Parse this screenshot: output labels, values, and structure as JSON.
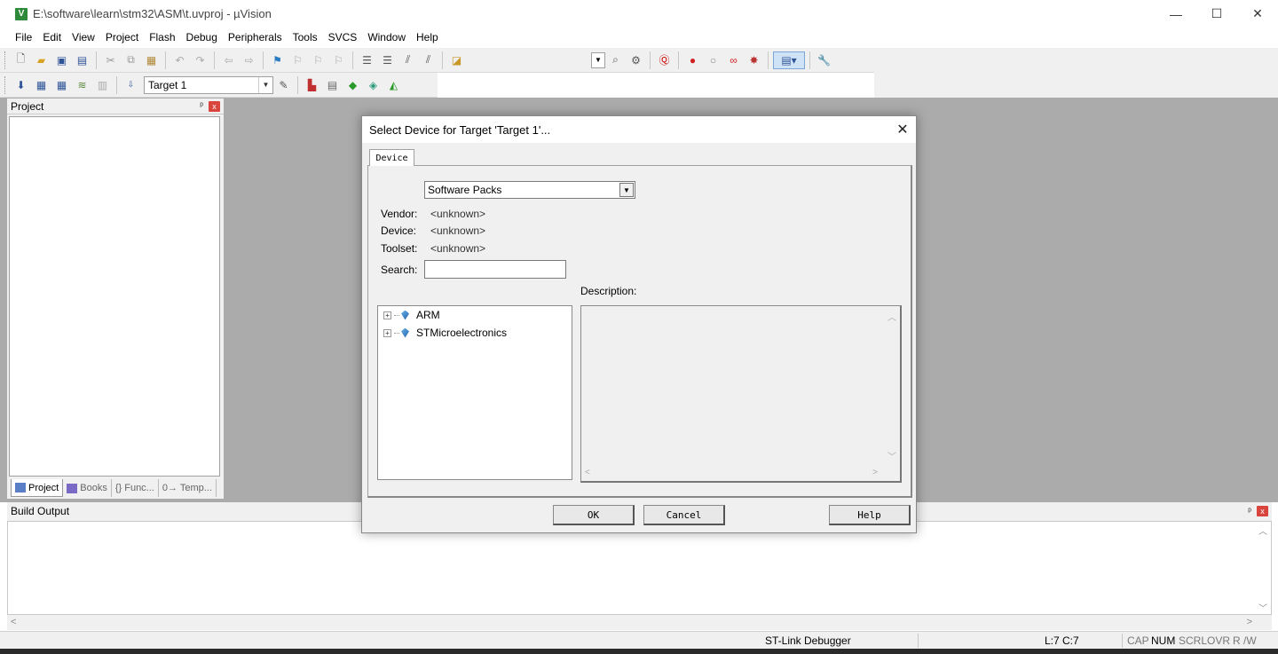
{
  "window": {
    "app_icon": "V",
    "title": "E:\\software\\learn\\stm32\\ASM\\t.uvproj - µVision",
    "controls": {
      "minimize": "—",
      "maximize": "☐",
      "close": "✕"
    }
  },
  "menu": {
    "items": [
      "File",
      "Edit",
      "View",
      "Project",
      "Flash",
      "Debug",
      "Peripherals",
      "Tools",
      "SVCS",
      "Window",
      "Help"
    ]
  },
  "toolbar2": {
    "target": "Target 1"
  },
  "project_panel": {
    "title": "Project",
    "pin": "ᵖ",
    "close": "x",
    "tabs": [
      "Project",
      "Books",
      "{} Func...",
      "0→ Temp..."
    ]
  },
  "build_output": {
    "title": "Build Output",
    "pin": "ᵖ",
    "close": "x"
  },
  "statusbar": {
    "debugger": "ST-Link Debugger",
    "position": "L:7 C:7",
    "cap": "CAP",
    "num": "NUM",
    "scrl": "SCRL",
    "ovr": "OVR",
    "rw": "R /W"
  },
  "dialog": {
    "title": "Select Device for Target 'Target 1'...",
    "close": "✕",
    "tab": "Device",
    "source_select": "Software Packs",
    "vendor_label": "Vendor:",
    "vendor_value": "<unknown>",
    "device_label": "Device:",
    "device_value": "<unknown>",
    "toolset_label": "Toolset:",
    "toolset_value": "<unknown>",
    "search_label": "Search:",
    "search_value": "",
    "description_label": "Description:",
    "tree": [
      {
        "label": "ARM",
        "expander": "+"
      },
      {
        "label": "STMicroelectronics",
        "expander": "+"
      }
    ],
    "buttons": {
      "ok": "OK",
      "cancel": "Cancel",
      "help": "Help"
    }
  },
  "colors": {
    "workspace": "#ababab",
    "chrome": "#f0f0f0",
    "close_red": "#d9443c",
    "breakpoint_red": "#d21f1f"
  }
}
